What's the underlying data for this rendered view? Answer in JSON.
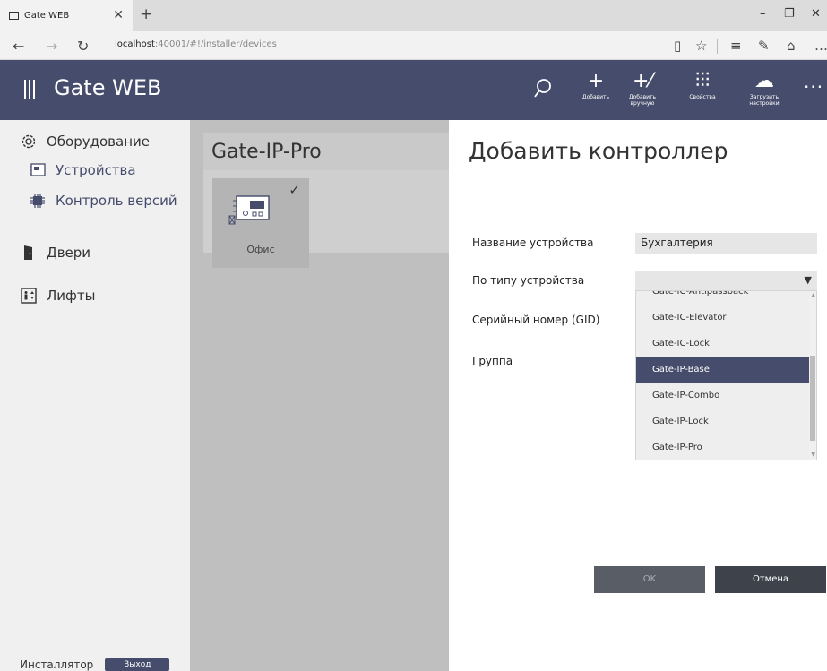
{
  "browser": {
    "tab_title": "Gate WEB",
    "url_host": "localhost",
    "url_rest": ":40001/#!/installer/devices"
  },
  "app": {
    "title": "Gate WEB",
    "toolbar": [
      {
        "label": "Добавить",
        "icon": "plus-icon"
      },
      {
        "label": "Добавить вручную",
        "icon": "add-manual-icon"
      },
      {
        "label": "Свойства",
        "icon": "sliders-icon"
      },
      {
        "label": "Загрузить настройки",
        "icon": "cloud-upload-icon"
      }
    ]
  },
  "sidebar": {
    "items": [
      {
        "label": "Оборудование",
        "icon": "gear-icon"
      },
      {
        "label": "Устройства",
        "icon": "device-board-icon"
      },
      {
        "label": "Контроль версий",
        "icon": "chip-icon"
      },
      {
        "label": "Двери",
        "icon": "door-icon"
      },
      {
        "label": "Лифты",
        "icon": "elevator-icon"
      }
    ],
    "footer_user": "Инсталлятор",
    "logout": "Выход"
  },
  "main": {
    "group_title": "Gate-IP-Pro",
    "device_name": "Офис"
  },
  "dialog": {
    "title": "Добавить контроллер",
    "labels": {
      "device_name": "Название устройства",
      "device_type": "По типу устройства",
      "serial": "Серийный номер (GID)",
      "group": "Группа"
    },
    "device_name_value": "Бухгалтерия",
    "options": [
      "Gate-IC-Antipassback",
      "Gate-IC-Elevator",
      "Gate-IC-Lock",
      "Gate-IP-Base",
      "Gate-IP-Combo",
      "Gate-IP-Lock",
      "Gate-IP-Pro"
    ],
    "selected_option": "Gate-IP-Base",
    "ok": "OK",
    "cancel": "Отмена"
  },
  "colors": {
    "accent": "#464c6b",
    "sidebar_bg": "#f0f0f0",
    "main_bg": "#bfbfbf"
  }
}
